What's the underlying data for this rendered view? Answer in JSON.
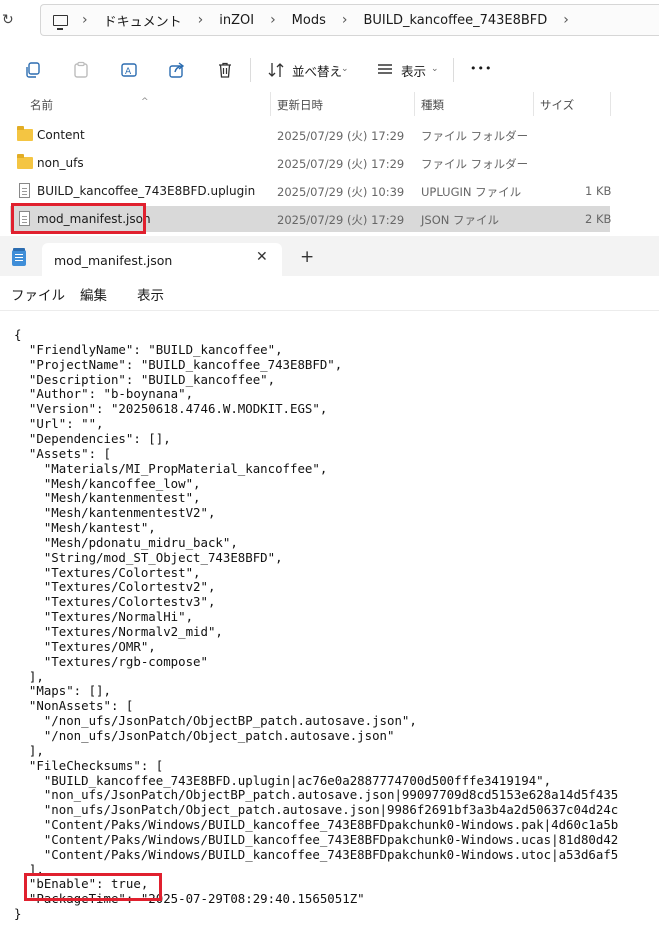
{
  "explorer": {
    "breadcrumb": [
      "ドキュメント",
      "inZOI",
      "Mods",
      "BUILD_kancoffee_743E8BFD"
    ],
    "toolbar": {
      "sort_label": "並べ替え",
      "view_label": "表示",
      "more_label": "•••"
    },
    "columns": {
      "name": "名前",
      "date": "更新日時",
      "type": "種類",
      "size": "サイズ"
    },
    "files": [
      {
        "name": "Content",
        "date": "2025/07/29 (火) 17:29",
        "type": "ファイル フォルダー",
        "size": "",
        "kind": "folder"
      },
      {
        "name": "non_ufs",
        "date": "2025/07/29 (火) 17:29",
        "type": "ファイル フォルダー",
        "size": "",
        "kind": "folder"
      },
      {
        "name": "BUILD_kancoffee_743E8BFD.uplugin",
        "date": "2025/07/29 (火) 10:39",
        "type": "UPLUGIN ファイル",
        "size": "1 KB",
        "kind": "file"
      },
      {
        "name": "mod_manifest.json",
        "date": "2025/07/29 (火) 17:29",
        "type": "JSON ファイル",
        "size": "2 KB",
        "kind": "file",
        "selected": true
      }
    ]
  },
  "notepad": {
    "tab_title": "mod_manifest.json",
    "close_glyph": "✕",
    "newtab_glyph": "+",
    "menu": {
      "file": "ファイル",
      "edit": "編集",
      "view": "表示"
    },
    "lines": [
      "{",
      "  \"FriendlyName\": \"BUILD_kancoffee\",",
      "  \"ProjectName\": \"BUILD_kancoffee_743E8BFD\",",
      "  \"Description\": \"BUILD_kancoffee\",",
      "  \"Author\": \"b-boynana\",",
      "  \"Version\": \"20250618.4746.W.MODKIT.EGS\",",
      "  \"Url\": \"\",",
      "  \"Dependencies\": [],",
      "  \"Assets\": [",
      "    \"Materials/MI_PropMaterial_kancoffee\",",
      "    \"Mesh/kancoffee_low\",",
      "    \"Mesh/kantenmentest\",",
      "    \"Mesh/kantenmentestV2\",",
      "    \"Mesh/kantest\",",
      "    \"Mesh/pdonatu_midru_back\",",
      "    \"String/mod_ST_Object_743E8BFD\",",
      "    \"Textures/Colortest\",",
      "    \"Textures/Colortestv2\",",
      "    \"Textures/Colortestv3\",",
      "    \"Textures/NormalHi\",",
      "    \"Textures/Normalv2_mid\",",
      "    \"Textures/OMR\",",
      "    \"Textures/rgb-compose\"",
      "  ],",
      "  \"Maps\": [],",
      "  \"NonAssets\": [",
      "    \"/non_ufs/JsonPatch/ObjectBP_patch.autosave.json\",",
      "    \"/non_ufs/JsonPatch/Object_patch.autosave.json\"",
      "  ],",
      "  \"FileChecksums\": [",
      "    \"BUILD_kancoffee_743E8BFD.uplugin|ac76e0a2887774700d500fffe3419194\",",
      "    \"non_ufs/JsonPatch/ObjectBP_patch.autosave.json|99097709d8cd5153e628a14d5f435",
      "    \"non_ufs/JsonPatch/Object_patch.autosave.json|9986f2691bf3a3b4a2d50637c04d24c",
      "    \"Content/Paks/Windows/BUILD_kancoffee_743E8BFDpakchunk0-Windows.pak|4d60c1a5b",
      "    \"Content/Paks/Windows/BUILD_kancoffee_743E8BFDpakchunk0-Windows.ucas|81d80d42",
      "    \"Content/Paks/Windows/BUILD_kancoffee_743E8BFDpakchunk0-Windows.utoc|a53d6af5",
      "  ],",
      "  \"bEnable\": true,",
      "  \"PackageTime\": \"2025-07-29T08:29:40.1565051Z\"",
      "}"
    ]
  }
}
